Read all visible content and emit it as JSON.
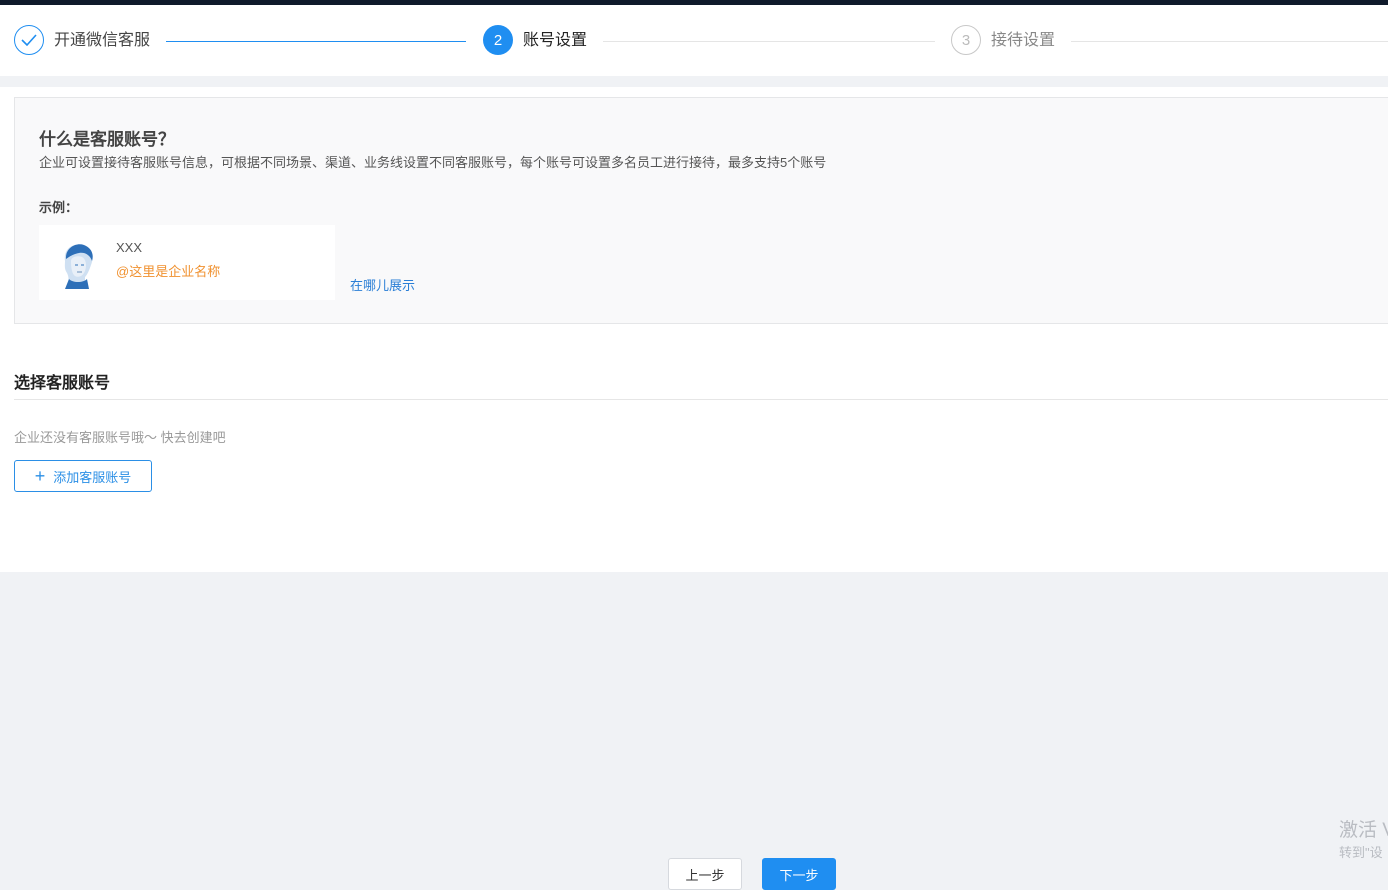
{
  "steps": [
    {
      "number": "",
      "label": "开通微信客服",
      "state": "done"
    },
    {
      "number": "2",
      "label": "账号设置",
      "state": "active"
    },
    {
      "number": "3",
      "label": "接待设置",
      "state": "pending"
    }
  ],
  "info": {
    "title": "什么是客服账号？",
    "description": "企业可设置接待客服账号信息，可根据不同场景、渠道、业务线设置不同客服账号，每个账号可设置多名员工进行接待，最多支持5个账号",
    "example_label": "示例：",
    "example_name": "XXX",
    "example_corp": "@这里是企业名称",
    "where_link": "在哪儿展示"
  },
  "select_section": {
    "title": "选择客服账号",
    "empty_text": "企业还没有客服账号哦～ 快去创建吧",
    "add_button": "添加客服账号"
  },
  "footer": {
    "prev_button": "上一步",
    "next_button": "下一步"
  },
  "watermark": {
    "line1": "激活 V",
    "line2": "转到\"设"
  },
  "colors": {
    "accent": "#1f8ef1",
    "link": "#2b7fd6",
    "corp_name": "#f0912f",
    "top_bar": "#0f1a2b"
  }
}
